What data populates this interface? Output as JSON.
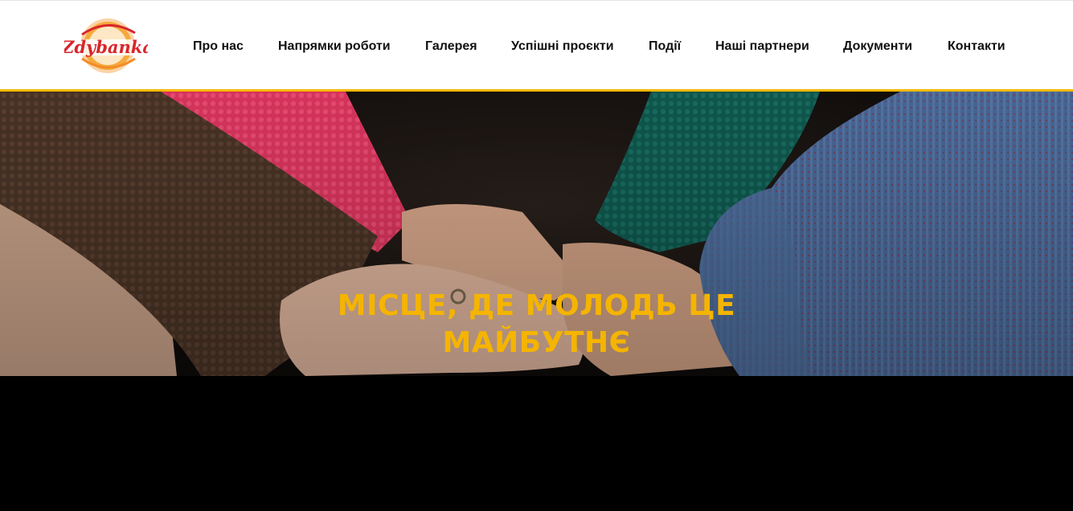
{
  "brand": {
    "logo_text": "Zdybanka",
    "colors": {
      "accent": "#f5b800",
      "title": "#f4b400",
      "logo_red": "#d7262d",
      "logo_orange": "#f28c28"
    }
  },
  "nav": {
    "items": [
      {
        "label": "Про нас"
      },
      {
        "label": "Напрямки роботи"
      },
      {
        "label": "Галерея"
      },
      {
        "label": "Успішні проєкти"
      },
      {
        "label": "Події"
      },
      {
        "label": "Наші партнери"
      },
      {
        "label": "Документи"
      },
      {
        "label": "Контакти"
      }
    ]
  },
  "hero": {
    "title_line1": "МІСЦЕ, ДЕ МОЛОДЬ ЦЕ",
    "title_line2": "МАЙБУТНЄ",
    "image": "hands-in-knitted-sleeves"
  }
}
